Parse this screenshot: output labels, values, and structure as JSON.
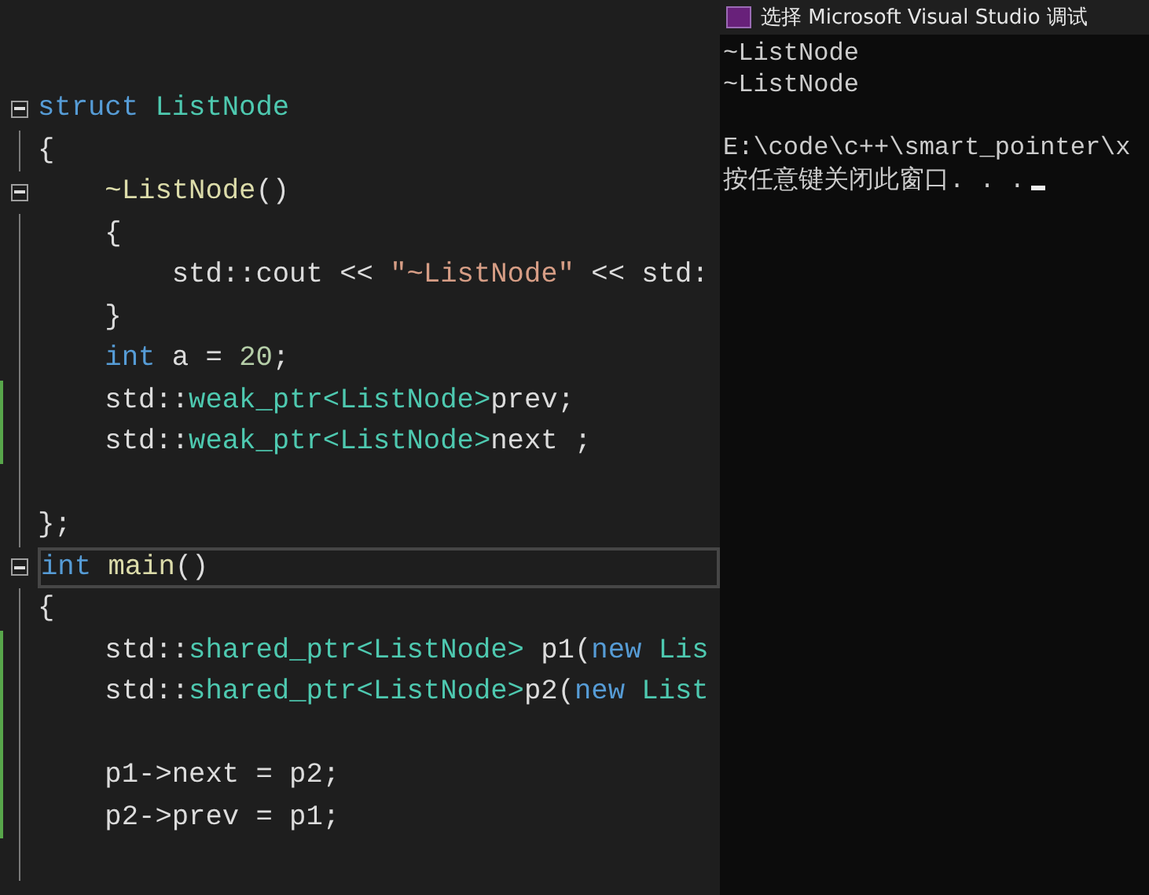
{
  "editor": {
    "lines": [
      {
        "fold": true,
        "changed": false,
        "current": false,
        "tokens": [
          {
            "kind": "keyword",
            "text": "struct "
          },
          {
            "kind": "type",
            "text": "ListNode"
          }
        ]
      },
      {
        "fold": false,
        "changed": false,
        "current": false,
        "tokens": [
          {
            "kind": "plain",
            "text": "{"
          }
        ]
      },
      {
        "fold": true,
        "changed": false,
        "current": false,
        "tokens": [
          {
            "kind": "function",
            "text": "    ~ListNode"
          },
          {
            "kind": "plain",
            "text": "()"
          }
        ]
      },
      {
        "fold": false,
        "changed": false,
        "current": false,
        "tokens": [
          {
            "kind": "plain",
            "text": "    {"
          }
        ]
      },
      {
        "fold": false,
        "changed": false,
        "current": false,
        "tokens": [
          {
            "kind": "plain",
            "text": "        std::cout << "
          },
          {
            "kind": "string",
            "text": "\"~ListNode\""
          },
          {
            "kind": "plain",
            "text": " << std:"
          }
        ]
      },
      {
        "fold": false,
        "changed": false,
        "current": false,
        "tokens": [
          {
            "kind": "plain",
            "text": "    }"
          }
        ]
      },
      {
        "fold": false,
        "changed": false,
        "current": false,
        "tokens": [
          {
            "kind": "keyword",
            "text": "    int"
          },
          {
            "kind": "plain",
            "text": " a = "
          },
          {
            "kind": "number",
            "text": "20"
          },
          {
            "kind": "plain",
            "text": ";"
          }
        ]
      },
      {
        "fold": false,
        "changed": true,
        "current": false,
        "tokens": [
          {
            "kind": "plain",
            "text": "    std::"
          },
          {
            "kind": "type",
            "text": "weak_ptr<ListNode>"
          },
          {
            "kind": "plain",
            "text": "prev;"
          }
        ]
      },
      {
        "fold": false,
        "changed": true,
        "current": false,
        "tokens": [
          {
            "kind": "plain",
            "text": "    std::"
          },
          {
            "kind": "type",
            "text": "weak_ptr<ListNode>"
          },
          {
            "kind": "plain",
            "text": "next ;"
          }
        ]
      },
      {
        "changed": false
      },
      {
        "fold": false,
        "changed": false,
        "current": false,
        "tokens": [
          {
            "kind": "plain",
            "text": "};"
          }
        ]
      },
      {
        "fold": true,
        "changed": false,
        "current": true,
        "tokens": [
          {
            "kind": "keyword",
            "text": "int "
          },
          {
            "kind": "function",
            "text": "main"
          },
          {
            "kind": "plain",
            "text": "()"
          }
        ]
      },
      {
        "fold": false,
        "changed": false,
        "current": false,
        "tokens": [
          {
            "kind": "plain",
            "text": "{"
          }
        ]
      },
      {
        "fold": false,
        "changed": true,
        "current": false,
        "tokens": [
          {
            "kind": "plain",
            "text": "    std::"
          },
          {
            "kind": "type",
            "text": "shared_ptr<ListNode>"
          },
          {
            "kind": "plain",
            "text": " p1("
          },
          {
            "kind": "keyword",
            "text": "new "
          },
          {
            "kind": "type",
            "text": "Lis"
          }
        ]
      },
      {
        "fold": false,
        "changed": true,
        "current": false,
        "tokens": [
          {
            "kind": "plain",
            "text": "    std::"
          },
          {
            "kind": "type",
            "text": "shared_ptr<ListNode>"
          },
          {
            "kind": "plain",
            "text": "p2("
          },
          {
            "kind": "keyword",
            "text": "new "
          },
          {
            "kind": "type",
            "text": "List"
          }
        ]
      },
      {
        "changed": true
      },
      {
        "fold": false,
        "changed": true,
        "current": false,
        "tokens": [
          {
            "kind": "plain",
            "text": "    p1->next = p2;"
          }
        ]
      },
      {
        "fold": false,
        "changed": true,
        "current": false,
        "tokens": [
          {
            "kind": "plain",
            "text": "    p2->prev = p1;"
          }
        ]
      },
      {
        "changed": false
      }
    ]
  },
  "console": {
    "title": "选择 Microsoft Visual Studio 调试",
    "blocks": [
      [
        "~ListNode",
        "~ListNode"
      ],
      [
        "E:\\code\\c++\\smart_pointer\\x",
        "按任意键关闭此窗口. . ."
      ]
    ],
    "cursor": true
  }
}
